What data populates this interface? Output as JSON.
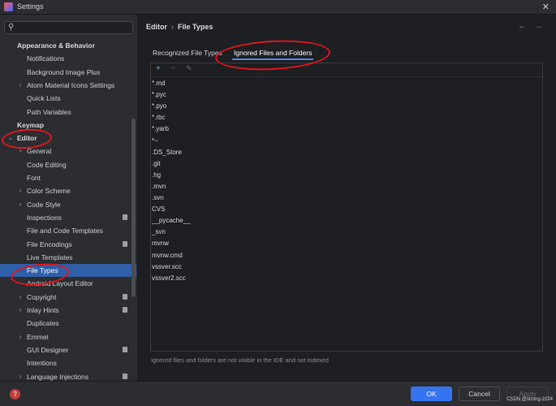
{
  "window": {
    "title": "Settings"
  },
  "search": {
    "value": "",
    "placeholder": ""
  },
  "sidebar": {
    "items": [
      {
        "label": "Appearance & Behavior",
        "chevron": "",
        "section": true
      },
      {
        "label": "Notifications",
        "chevron": ""
      },
      {
        "label": "Background Image Plus",
        "chevron": ""
      },
      {
        "label": "Atom Material Icons Settings",
        "chevron": "›"
      },
      {
        "label": "Quick Lists",
        "chevron": ""
      },
      {
        "label": "Path Variables",
        "chevron": ""
      },
      {
        "label": "Keymap",
        "chevron": "",
        "section": true
      },
      {
        "label": "Editor",
        "chevron": "⌄",
        "section": true
      },
      {
        "label": "General",
        "chevron": "›"
      },
      {
        "label": "Code Editing",
        "chevron": ""
      },
      {
        "label": "Font",
        "chevron": ""
      },
      {
        "label": "Color Scheme",
        "chevron": "›"
      },
      {
        "label": "Code Style",
        "chevron": "›"
      },
      {
        "label": "Inspections",
        "chevron": "",
        "lock": true
      },
      {
        "label": "File and Code Templates",
        "chevron": ""
      },
      {
        "label": "File Encodings",
        "chevron": "",
        "lock": true
      },
      {
        "label": "Live Templates",
        "chevron": ""
      },
      {
        "label": "File Types",
        "chevron": "",
        "selected": true
      },
      {
        "label": "Android Layout Editor",
        "chevron": ""
      },
      {
        "label": "Copyright",
        "chevron": "›",
        "lock": true
      },
      {
        "label": "Inlay Hints",
        "chevron": "›",
        "lock": true
      },
      {
        "label": "Duplicates",
        "chevron": ""
      },
      {
        "label": "Emmet",
        "chevron": "›"
      },
      {
        "label": "GUI Designer",
        "chevron": "",
        "lock": true
      },
      {
        "label": "Intentions",
        "chevron": ""
      },
      {
        "label": "Language Injections",
        "chevron": "›",
        "lock": true
      }
    ]
  },
  "breadcrumb": {
    "parent": "Editor",
    "separator": "›",
    "current": "File Types"
  },
  "nav": {
    "back": "←",
    "forward": "→"
  },
  "tabs": [
    {
      "label": "Recognized File Types",
      "active": false
    },
    {
      "label": "Ignored Files and Folders",
      "active": true
    }
  ],
  "toolbar": {
    "add": "+",
    "remove": "−",
    "edit": "✎"
  },
  "ignored_files": [
    "*.md",
    "*.pyc",
    "*.pyo",
    "*.rbc",
    "*.yarb",
    "*~",
    ".DS_Store",
    ".git",
    ".hg",
    ".mvn",
    ".svn",
    "CVS",
    "__pycache__",
    "_svn",
    "mvnw",
    "mvnw.cmd",
    "vssver.scc",
    "vssver2.scc"
  ],
  "hint": "Ignored files and folders are not visible in the IDE and not indexed",
  "buttons": {
    "ok": "OK",
    "cancel": "Cancel",
    "apply": "Apply"
  },
  "help": "?",
  "watermark": "CSDN @strong-1024",
  "colors": {
    "accent": "#3574f0",
    "selected": "#2f5fa8",
    "annotation": "#e0161c",
    "background": "#1e1f22"
  }
}
